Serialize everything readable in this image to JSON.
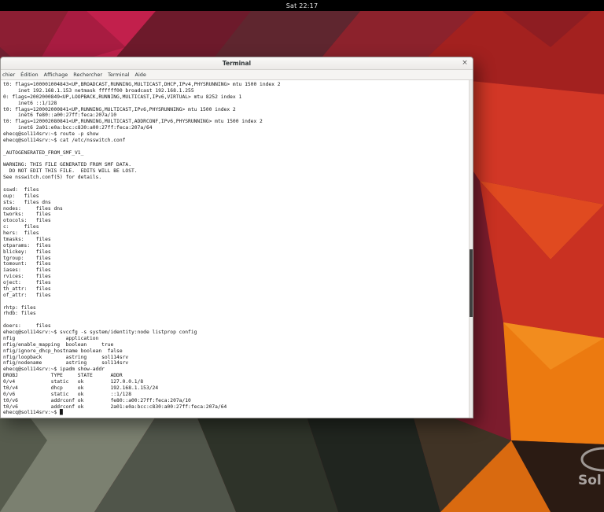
{
  "topbar": {
    "clock": "Sat 22:17"
  },
  "window": {
    "title": "Terminal",
    "close_label": "×",
    "menus": [
      "chier",
      "Édition",
      "Affichage",
      "Rechercher",
      "Terminal",
      "Aide"
    ]
  },
  "terminal": {
    "lines": [
      "t0: flags=100001004843<UP,BROADCAST,RUNNING,MULTICAST,DHCP,IPv4,PHYSRUNNING> mtu 1500 index 2",
      "     inet 192.168.1.153 netmask ffffff00 broadcast 192.168.1.255",
      "0: flags=2002000849<UP,LOOPBACK,RUNNING,MULTICAST,IPv6,VIRTUAL> mtu 8252 index 1",
      "     inet6 ::1/128",
      "t0: flags=120002000841<UP,RUNNING,MULTICAST,IPv6,PHYSRUNNING> mtu 1500 index 2",
      "     inet6 fe80::a00:27ff:feca:207a/10",
      "t0: flags=120002080841<UP,RUNNING,MULTICAST,ADDRCONF,IPv6,PHYSRUNNING> mtu 1500 index 2",
      "     inet6 2a01:e0a:bcc:c830:a00:27ff:feca:207a/64",
      "ehecq@sol114srv:~$ route -p show",
      "ehecq@sol114srv:~$ cat /etc/nsswitch.conf",
      "",
      "_AUTOGENERATED_FROM_SMF_V1_",
      "",
      "WARNING: THIS FILE GENERATED FROM SMF DATA.",
      "  DO NOT EDIT THIS FILE.  EDITS WILL BE LOST.",
      "See nsswitch.conf(5) for details.",
      "",
      "sswd:  files",
      "oup:   files",
      "sts:   files dns",
      "nodes:     files dns",
      "tworks:    files",
      "otocols:   files",
      "c:     files",
      "hers:  files",
      "tmasks:    files",
      "otparams:  files",
      "blickey:   files",
      "tgroup:    files",
      "tomount:   files",
      "iases:     files",
      "rvices:    files",
      "oject:     files",
      "th_attr:   files",
      "of_attr:   files",
      "",
      "rhtp: files",
      "rhdb: files",
      "",
      "doers:     files",
      "ehecq@sol114srv:~$ svccfg -s system/identity:node listprop config",
      "nfig                 application",
      "nfig/enable_mapping  boolean     true",
      "nfig/ignore_dhcp_hostname boolean  false",
      "nfig/loopback        astring     sol114srv",
      "nfig/nodename        astring     sol114srv",
      "ehecq@sol114srv:~$ ipadm show-addr",
      "DROBJ           TYPE     STATE      ADDR",
      "0/v4            static   ok         127.0.0.1/8",
      "t0/v4           dhcp     ok         192.168.1.153/24",
      "0/v6            static   ok         ::1/128",
      "t0/v6           addrconf ok         fe80::a00:27ff:feca:207a/10",
      "t0/v6           addrconf ok         2a01:e0a:bcc:c830:a00:27ff:feca:207a/64",
      "ehecq@sol114srv:~$ █"
    ]
  },
  "watermark": {
    "text": "Sol"
  },
  "colors": {
    "panel": "#000000",
    "accent_red": "#d23726",
    "accent_orange": "#ec7a10",
    "accent_magenta": "#c2204c",
    "olive_gray": "#6a6f60",
    "terminal_bg": "#ffffff",
    "terminal_text": "#161616"
  }
}
